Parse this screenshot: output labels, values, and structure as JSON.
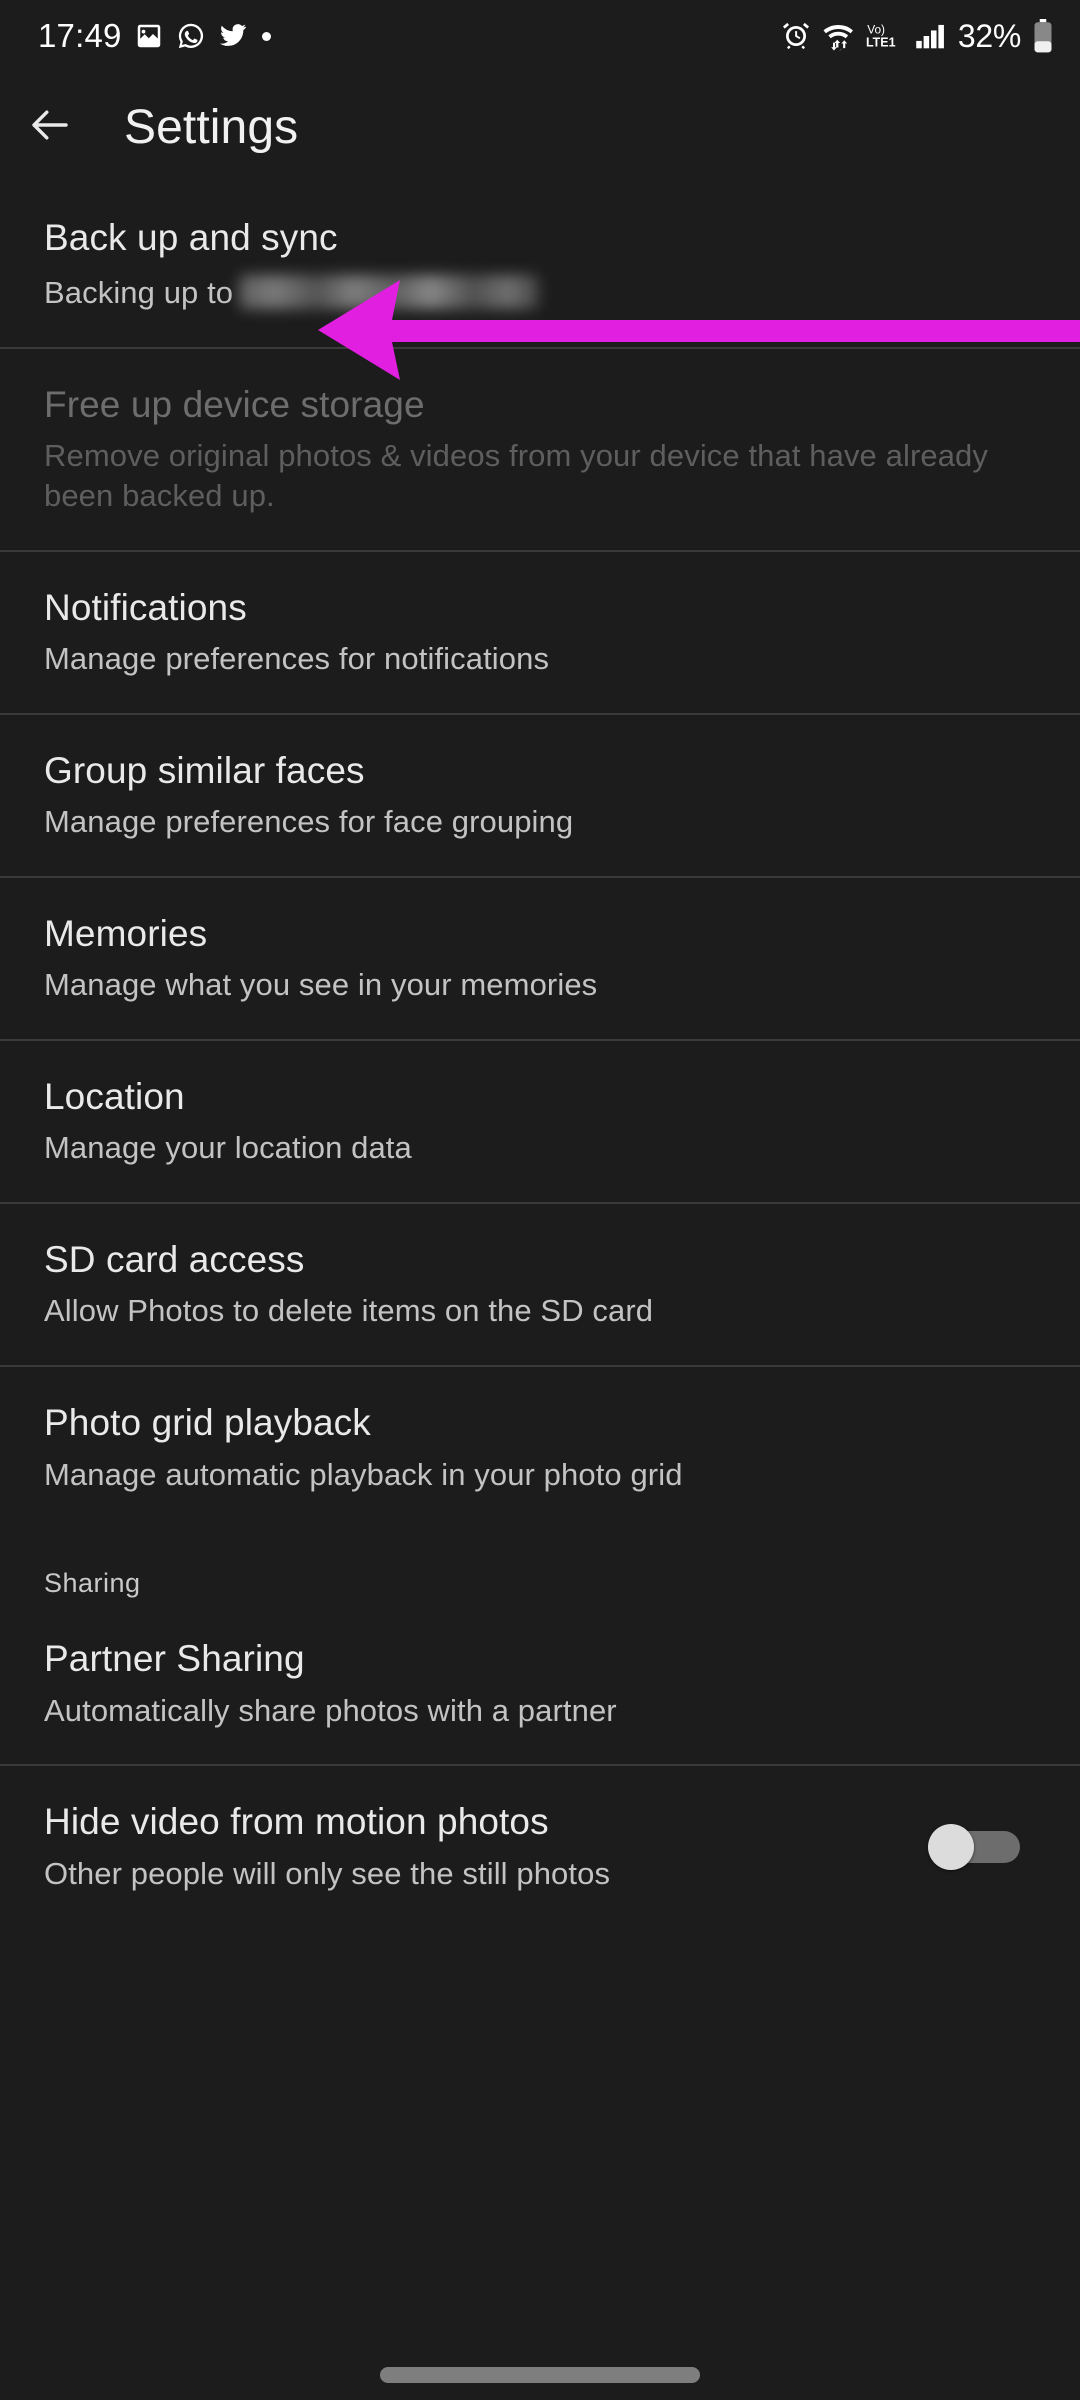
{
  "status_bar": {
    "time": "17:49",
    "left_icons": [
      "photos-icon",
      "whatsapp-icon",
      "twitter-icon",
      "dot-icon"
    ],
    "right_icons": [
      "alarm-icon",
      "wifi-icon",
      "volte-icon",
      "signal-icon"
    ],
    "volte_label": "Vo)",
    "volte_sub": "LTE1",
    "battery_percent": "32%"
  },
  "header": {
    "back_icon": "back-arrow-icon",
    "title": "Settings"
  },
  "settings": {
    "items": [
      {
        "title": "Back up and sync",
        "subtitle_prefix": "Backing up to",
        "redacted": true,
        "disabled": false,
        "divider_below": true,
        "toggle": null
      },
      {
        "title": "Free up device storage",
        "subtitle": "Remove original photos & videos from your device that have already been backed up.",
        "disabled": true,
        "divider_below": true,
        "toggle": null
      },
      {
        "title": "Notifications",
        "subtitle": "Manage preferences for notifications",
        "disabled": false,
        "divider_below": true,
        "toggle": null
      },
      {
        "title": "Group similar faces",
        "subtitle": "Manage preferences for face grouping",
        "disabled": false,
        "divider_below": true,
        "toggle": null
      },
      {
        "title": "Memories",
        "subtitle": "Manage what you see in your memories",
        "disabled": false,
        "divider_below": true,
        "toggle": null
      },
      {
        "title": "Location",
        "subtitle": "Manage your location data",
        "disabled": false,
        "divider_below": true,
        "toggle": null
      },
      {
        "title": "SD card access",
        "subtitle": "Allow Photos to delete items on the SD card",
        "disabled": false,
        "divider_below": true,
        "toggle": null
      },
      {
        "title": "Photo grid playback",
        "subtitle": "Manage automatic playback in your photo grid",
        "disabled": false,
        "divider_below": false,
        "toggle": null
      }
    ],
    "section": {
      "label": "Sharing",
      "items": [
        {
          "title": "Partner Sharing",
          "subtitle": "Automatically share photos with a partner",
          "disabled": false,
          "divider_below": true,
          "toggle": null
        },
        {
          "title": "Hide video from motion photos",
          "subtitle": "Other people will only see the still photos",
          "disabled": false,
          "divider_below": false,
          "toggle": "off"
        }
      ]
    }
  },
  "annotation": {
    "arrow_icon": "left-arrow-annotation",
    "color": "#e01fe0",
    "points_to": "Back up and sync"
  },
  "system_nav": {
    "gesture_pill": "home-gesture-pill"
  },
  "colors": {
    "background": "#1c1c1c",
    "divider": "#3a3a3a",
    "title_text": "#e9e9e9",
    "subtitle_text": "#c3c3c3",
    "disabled_text": "#6d6d6d",
    "accent_annotation": "#e01fe0"
  }
}
